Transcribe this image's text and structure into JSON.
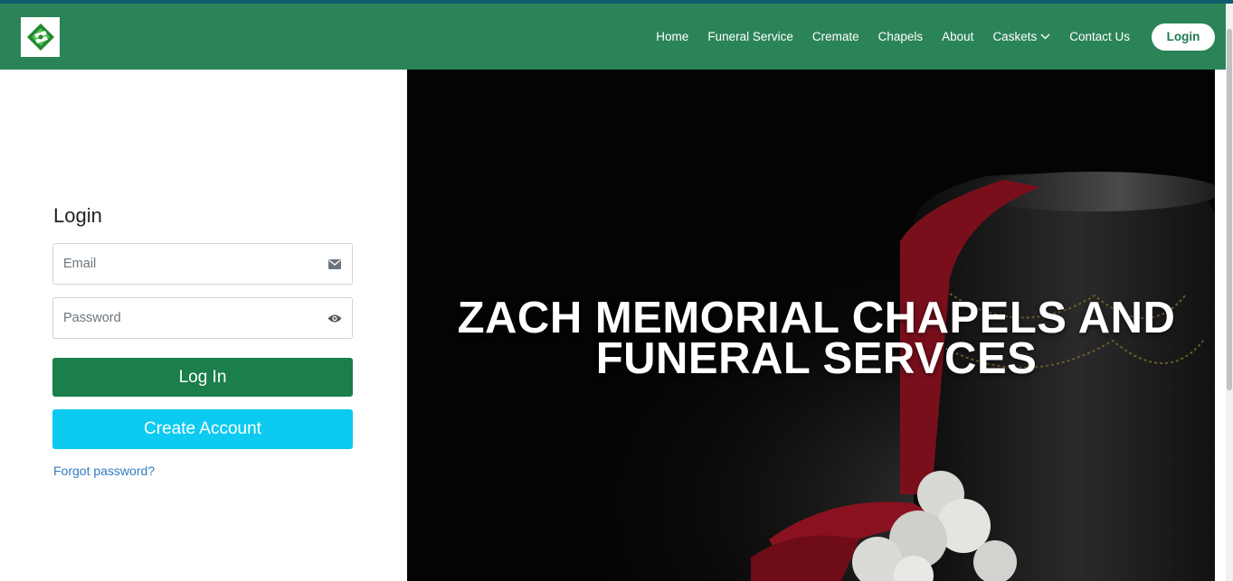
{
  "header": {
    "logo_icon": "brand-logo-icon",
    "nav": [
      {
        "label": "Home"
      },
      {
        "label": "Funeral Service"
      },
      {
        "label": "Cremate"
      },
      {
        "label": "Chapels"
      },
      {
        "label": "About"
      },
      {
        "label": "Caskets",
        "icon": "chevron-down-icon"
      },
      {
        "label": "Contact Us"
      }
    ],
    "login_button": "Login"
  },
  "login_form": {
    "title": "Login",
    "email": {
      "value": "",
      "placeholder": "Email",
      "icon": "envelope-icon"
    },
    "password": {
      "value": "",
      "placeholder": "Password",
      "icon": "eye-icon"
    },
    "login_button": "Log In",
    "create_button": "Create Account",
    "forgot_link": "Forgot password?"
  },
  "hero": {
    "title_line1": "ZACH MEMORIAL CHAPELS AND",
    "title_line2": "FUNERAL SERVCES"
  },
  "colors": {
    "nav_bg": "#2b8457",
    "primary_button": "#1a7f4b",
    "create_button": "#0dcaf0",
    "link": "#2f7cc1"
  }
}
